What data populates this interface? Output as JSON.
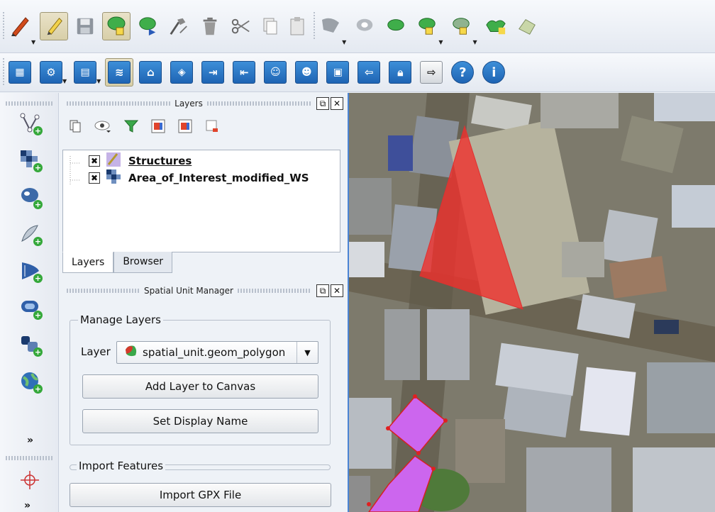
{
  "toolbar1": {
    "items": [
      "pencil-red-icon",
      "toggle-editing-icon",
      "save-edits-icon",
      "add-feature-icon",
      "move-feature-icon",
      "node-tool-icon",
      "delete-icon",
      "cut-icon",
      "copy-icon",
      "paste-icon",
      "simplify-icon",
      "add-ring-icon",
      "add-part-icon",
      "delete-ring-icon",
      "delete-part-icon",
      "reshape-icon",
      "offset-icon"
    ]
  },
  "toolbar2": {
    "items": [
      "table-icon",
      "settings-icon",
      "window-icon",
      "layers-icon",
      "house-icon",
      "map-icon",
      "import-icon",
      "export-icon",
      "user-edit-icon",
      "user-add-icon",
      "calculator-icon",
      "logout-icon",
      "lock-icon",
      "exit-icon",
      "help-icon",
      "info-icon"
    ]
  },
  "left_tools": [
    "add-vector-layer-icon",
    "add-raster-layer-icon",
    "add-postgis-layer-icon",
    "add-spatialite-layer-icon",
    "add-wms-layer-icon",
    "add-oracle-layer-icon",
    "add-mssql-layer-icon",
    "add-wcs-layer-icon"
  ],
  "layers_panel": {
    "title": "Layers",
    "layers": [
      {
        "name": "Structures",
        "checked": "✖"
      },
      {
        "name": "Area_of_Interest_modified_WS",
        "checked": "✖"
      }
    ],
    "tabs": [
      "Layers",
      "Browser"
    ]
  },
  "spatial_unit_manager": {
    "title": "Spatial Unit Manager",
    "manage_group": "Manage Layers",
    "layer_label": "Layer",
    "layer_value": "spatial_unit.geom_polygon",
    "add_button": "Add Layer to Canvas",
    "display_name_button": "Set Display Name",
    "import_group": "Import Features",
    "import_button": "Import GPX File"
  },
  "colors": {
    "highlight_polygon": "#f0302c",
    "selected_polygon": "#cc66ee"
  }
}
